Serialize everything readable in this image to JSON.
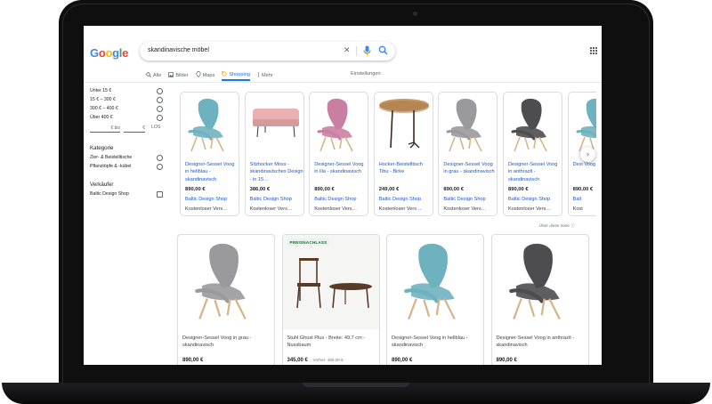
{
  "search": {
    "query": "skandinavische möbel"
  },
  "logo": {
    "letters": [
      "G",
      "o",
      "o",
      "g",
      "l",
      "e"
    ],
    "colors": [
      "#4285f4",
      "#ea4335",
      "#fbbc05",
      "#4285f4",
      "#34a853",
      "#ea4335"
    ]
  },
  "tabs": [
    {
      "label": "Alle",
      "icon": "search-icon"
    },
    {
      "label": "Bilder",
      "icon": "image-icon"
    },
    {
      "label": "Maps",
      "icon": "map-pin-icon"
    },
    {
      "label": "Shopping",
      "icon": "tag-icon",
      "active": true
    },
    {
      "label": "Mehr",
      "icon": "more-vert-icon"
    }
  ],
  "settings_label": "Einstellungen",
  "sidebar": {
    "price_options": [
      "Unter 15 €",
      "15 € – 300 €",
      "300 € – 400 €",
      "Über 400 €"
    ],
    "price_min_suffix": "€ bis",
    "price_max_suffix": "€",
    "price_go": "LOS",
    "category_heading": "Kategorie",
    "categories": [
      "Zier- & Beistelltische",
      "Pflanztöpfe & -kübel"
    ],
    "seller_heading": "Verkäufer",
    "sellers": [
      "Baltic Design Shop"
    ]
  },
  "carousel": [
    {
      "title": "Designer-Sessel Voog in hellblau - skandinavisch",
      "price": "890,00 €",
      "shop": "Baltic Design Shop",
      "shipping": "Kostenloser Vers…",
      "kind": "chair",
      "color": "#6fb2bf"
    },
    {
      "title": "Sitzhocker Moss - skandinavisches Design - in 15…",
      "price": "386,00 €",
      "shop": "Baltic Design Shop",
      "shipping": "Kostenloser Vers…",
      "kind": "ottoman",
      "color": "#eab1b1"
    },
    {
      "title": "Designer-Sessel Voog in lila - skandinavisch",
      "price": "890,00 €",
      "shop": "Baltic Design Shop",
      "shipping": "Kostenloser Vers…",
      "kind": "chair",
      "color": "#c97fa2"
    },
    {
      "title": "Hocker-Beistelltisch Tibu - Birke",
      "price": "249,00 €",
      "shop": "Baltic Design Shop",
      "shipping": "Kostenloser Vers…",
      "kind": "table",
      "color": "#c79a63"
    },
    {
      "title": "Designer-Sessel Voog in grau - skandinavisch",
      "price": "890,00 €",
      "shop": "Baltic Design Shop",
      "shipping": "Kostenloser Vers…",
      "kind": "chair",
      "color": "#9a9a9c"
    },
    {
      "title": "Designer-Sessel Voog in anthrazit - skandinavisch",
      "price": "890,00 €",
      "shop": "Baltic Design Shop",
      "shipping": "Kostenloser Vers…",
      "kind": "chair",
      "color": "#4d4d50"
    },
    {
      "title": "Desi Voog skan",
      "price": "890,00 €",
      "shop": "Balt",
      "shipping": "Kost",
      "kind": "chair",
      "color": "#6fb2bf"
    }
  ],
  "about_label": "Über diese Seite",
  "grid": [
    {
      "title": "Designer-Sessel Voog in grau - skandinavisch",
      "price": "890,00 €",
      "kind": "chair",
      "color": "#9a9a9c"
    },
    {
      "title": "Stuhl Ghost Plus - Breite: 49,7 cm - Nussbaum",
      "price": "345,00 €",
      "old_price": "· Vorher: 490,00 €",
      "badge": "PREISNACHLASS",
      "kind": "set",
      "color": "#5a3b28"
    },
    {
      "title": "Designer-Sessel Voog in hellblau - skandinavisch",
      "price": "890,00 €",
      "kind": "chair",
      "color": "#6fb2bf"
    },
    {
      "title": "Designer-Sessel Voog in anthrazit - skandinavisch",
      "price": "890,00 €",
      "kind": "chair",
      "color": "#4d4d50"
    }
  ]
}
